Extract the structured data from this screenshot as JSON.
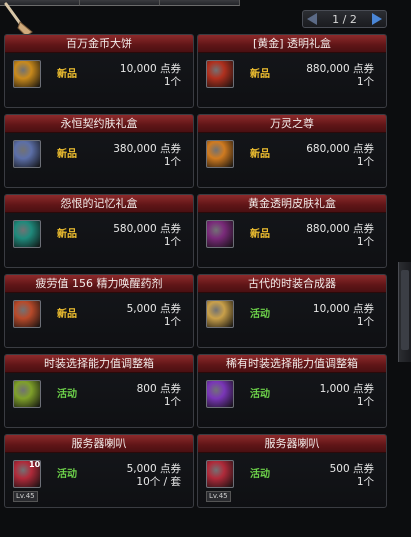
{
  "pager": {
    "text": "1 / 2"
  },
  "cards": [
    {
      "title": "百万金币大饼",
      "badge": "新品",
      "badge_type": "new",
      "price": "10,000 点券",
      "qty": "1个",
      "icon": "gold-coin-cake-icon",
      "color": "#c98a1c",
      "level": ""
    },
    {
      "title": "[黄金] 透明礼盒",
      "badge": "新品",
      "badge_type": "new",
      "price": "880,000 点券",
      "qty": "1个",
      "icon": "gold-gift-box-icon",
      "color": "#b0301e",
      "level": ""
    },
    {
      "title": "永恒契约肤礼盒",
      "badge": "新品",
      "badge_type": "new",
      "price": "380,000 点券",
      "qty": "1个",
      "icon": "feather-blade-icon",
      "color": "#5c6fa8",
      "level": ""
    },
    {
      "title": "万灵之尊",
      "badge": "新品",
      "badge_type": "new",
      "price": "680,000 点券",
      "qty": "1个",
      "icon": "golden-seal-icon",
      "color": "#d07b20",
      "level": ""
    },
    {
      "title": "怨恨的记忆礼盒",
      "badge": "新品",
      "badge_type": "new",
      "price": "580,000 点券",
      "qty": "1个",
      "icon": "teal-aura-icon",
      "color": "#1f8a7c",
      "level": ""
    },
    {
      "title": "黄金透明皮肤礼盒",
      "badge": "新品",
      "badge_type": "new",
      "price": "880,000 点券",
      "qty": "1个",
      "icon": "shadow-figure-icon",
      "color": "#7a2a7a",
      "level": ""
    },
    {
      "title": "疲劳值 156 精力唤醒药剂",
      "badge": "新品",
      "badge_type": "new",
      "price": "5,000 点券",
      "qty": "1个",
      "icon": "potion-bottle-icon",
      "color": "#b84a2a",
      "level": ""
    },
    {
      "title": "古代的时装合成器",
      "badge": "活动",
      "badge_type": "event",
      "price": "10,000 点券",
      "qty": "1个",
      "icon": "ancient-synthesizer-icon",
      "color": "#c9a04a",
      "level": ""
    },
    {
      "title": "时装选择能力值调整箱",
      "badge": "活动",
      "badge_type": "event",
      "price": "800 点券",
      "qty": "1个",
      "icon": "green-cube-icon",
      "color": "#7fa02a",
      "level": ""
    },
    {
      "title": "稀有时装选择能力值调整箱",
      "badge": "活动",
      "badge_type": "event",
      "price": "1,000 点券",
      "qty": "1个",
      "icon": "purple-cube-icon",
      "color": "#7a36b8",
      "level": ""
    },
    {
      "title": "服务器喇叭",
      "badge": "活动",
      "badge_type": "event",
      "price": "5,000 点券",
      "qty": "10个 / 套",
      "icon": "server-horn-icon",
      "color": "#b02a3a",
      "level": "Lv.45",
      "stack": "10"
    },
    {
      "title": "服务器喇叭",
      "badge": "活动",
      "badge_type": "event",
      "price": "500 点券",
      "qty": "1个",
      "icon": "server-horn-icon",
      "color": "#b02a3a",
      "level": "Lv.45"
    }
  ]
}
